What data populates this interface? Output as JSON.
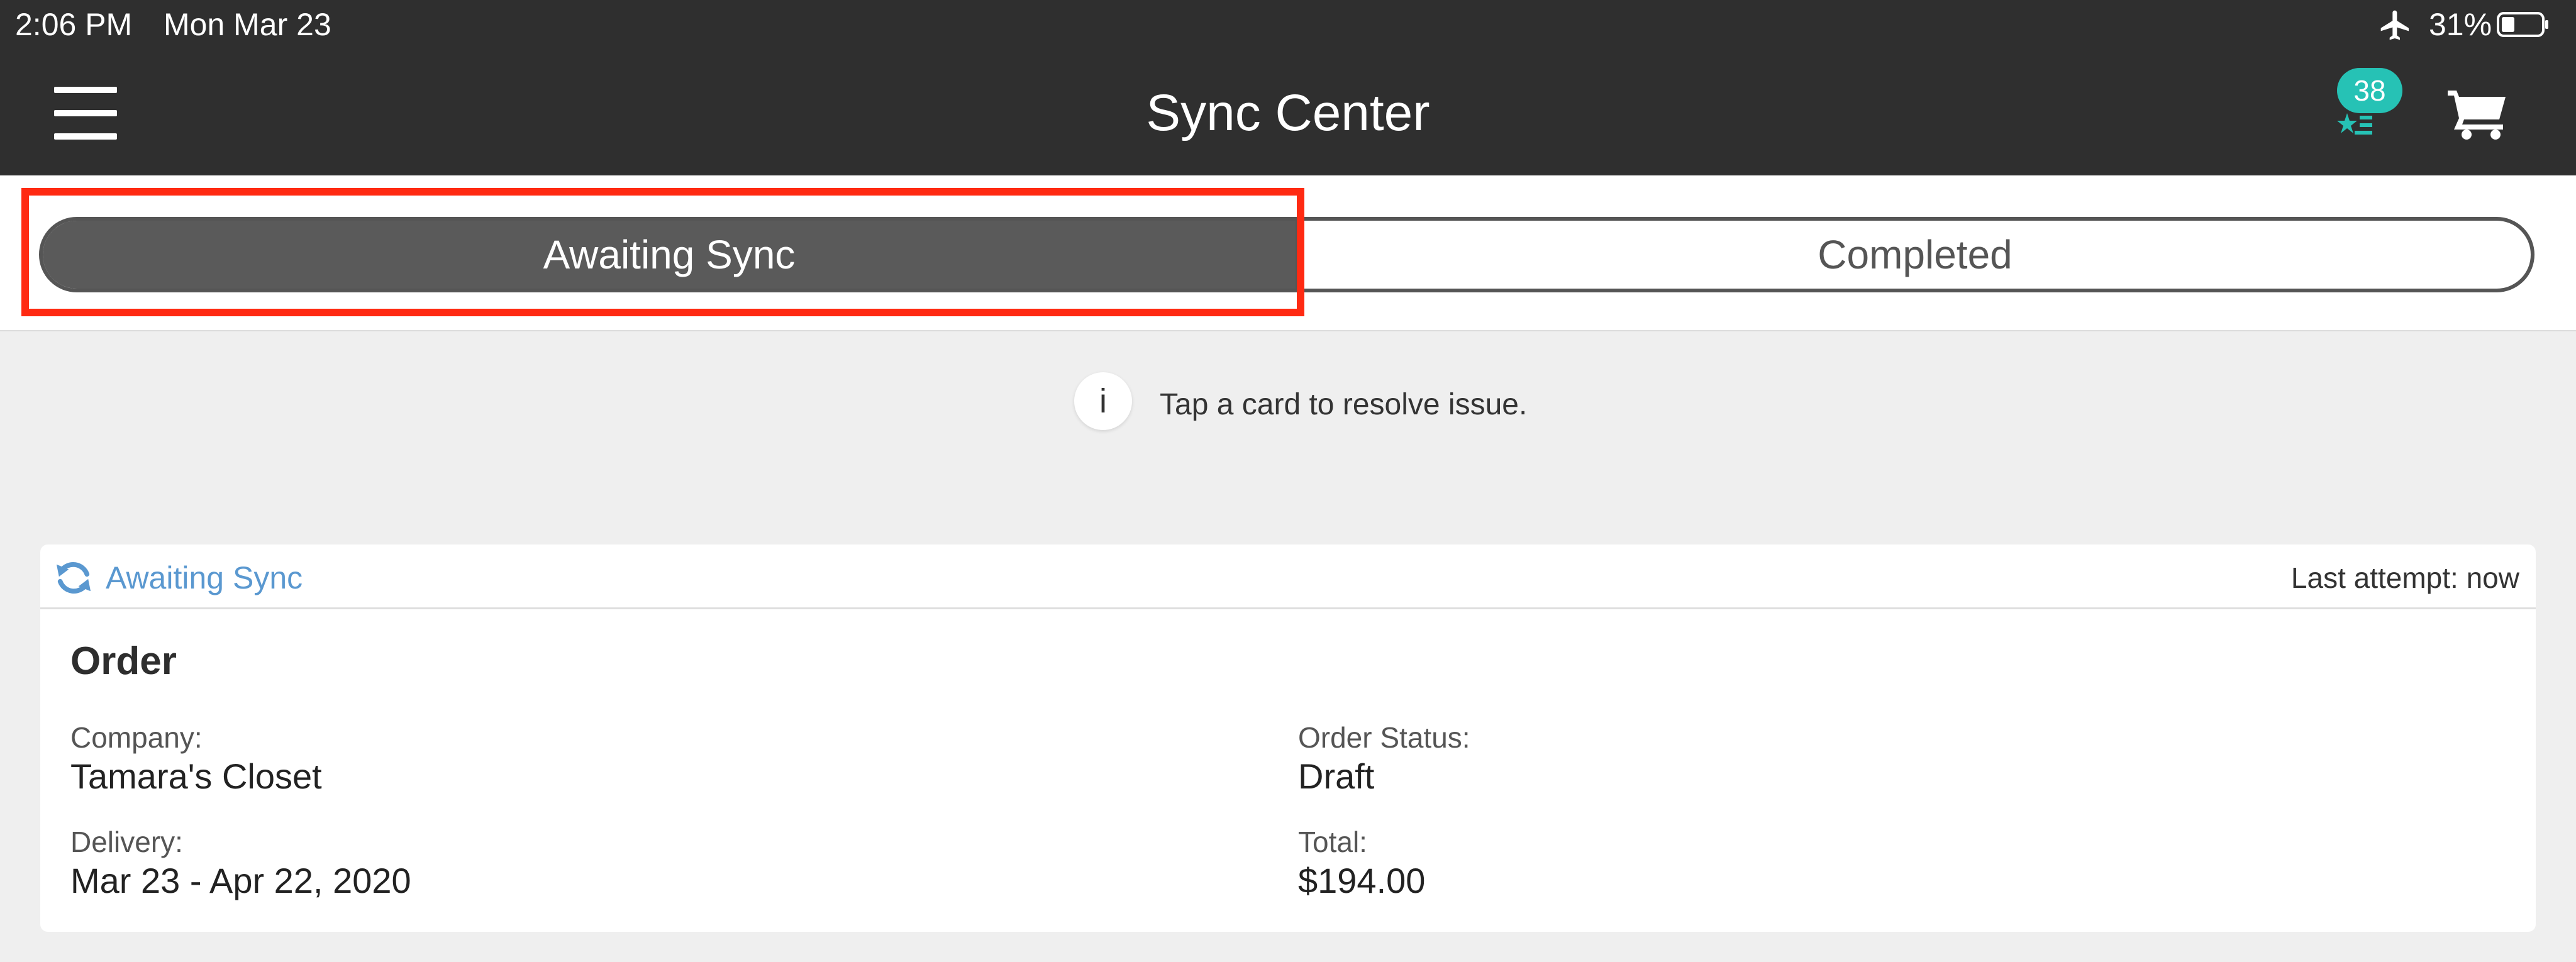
{
  "status_bar": {
    "time": "2:06 PM",
    "date": "Mon Mar 23",
    "battery": "31%"
  },
  "header": {
    "title": "Sync Center",
    "badge_count": "38"
  },
  "tabs": {
    "active": "Awaiting Sync",
    "inactive": "Completed"
  },
  "info": {
    "icon_letter": "i",
    "text": "Tap a card to resolve issue."
  },
  "card": {
    "status": "Awaiting Sync",
    "last_attempt": "Last attempt: now",
    "type": "Order",
    "company_label": "Company:",
    "company": "Tamara's Closet",
    "delivery_label": "Delivery:",
    "delivery": "Mar 23 - Apr 22, 2020",
    "status_label": "Order Status:",
    "order_status": "Draft",
    "total_label": "Total:",
    "total": "$194.00"
  },
  "colors": {
    "header_bg": "#2f2f2f",
    "badge": "#26c2b5",
    "active_tab": "#5a5a5a",
    "sync_blue": "#5a98d0",
    "highlight": "#ff2a12"
  }
}
